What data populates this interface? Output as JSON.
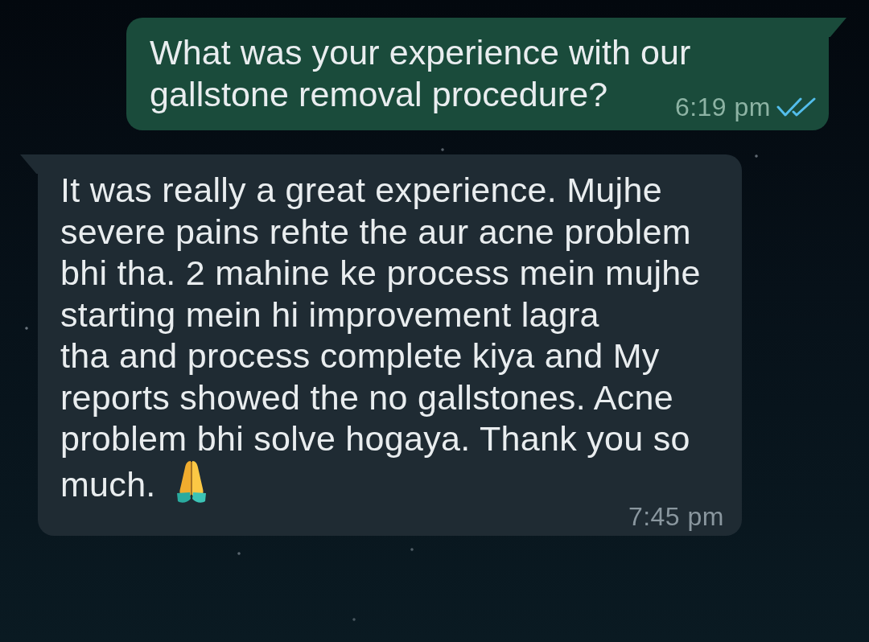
{
  "messages": [
    {
      "kind": "outgoing",
      "text": "What was your experience with our gallstone removal procedure?",
      "time": "6:19 pm",
      "read": true
    },
    {
      "kind": "incoming",
      "text": "It was really a great experience. Mujhe severe pains rehte the aur acne problem bhi tha. 2 mahine ke process mein mujhe starting mein hi improvement lagra\ntha and process complete kiya and My reports showed the no gallstones. Acne problem bhi solve hogaya. Thank you so much.",
      "time": "7:45 pm",
      "trailing_emoji": true
    }
  ]
}
